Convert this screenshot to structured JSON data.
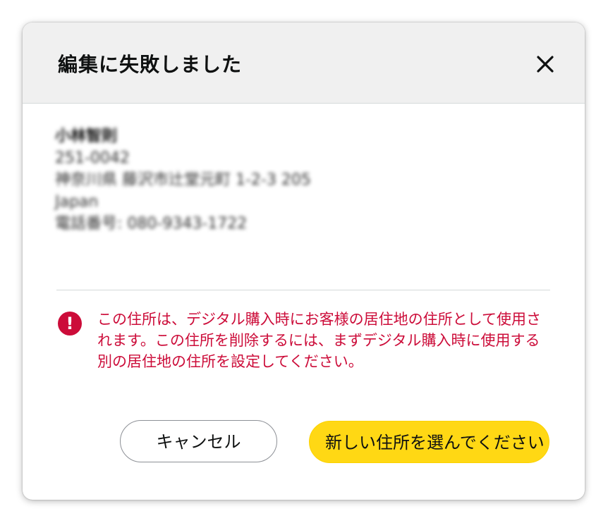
{
  "dialog": {
    "title": "編集に失敗しました",
    "close_icon": "close-icon"
  },
  "address": {
    "name": "小林智則",
    "postal": "251-0042",
    "street": "神奈川県 藤沢市辻堂元町 1-2-3 205",
    "country": "Japan",
    "phone": "電話番号: 080-9343-1722"
  },
  "alert": {
    "icon": "exclamation-icon",
    "message": "この住所は、デジタル購入時にお客様の居住地の住所として使用されます。この住所を削除するには、まずデジタル購入時に使用する別の居住地の住所を設定してください。",
    "color": "#cc0c39"
  },
  "buttons": {
    "cancel_label": "キャンセル",
    "primary_label": "新しい住所を選んでください",
    "primary_color": "#ffd814"
  }
}
